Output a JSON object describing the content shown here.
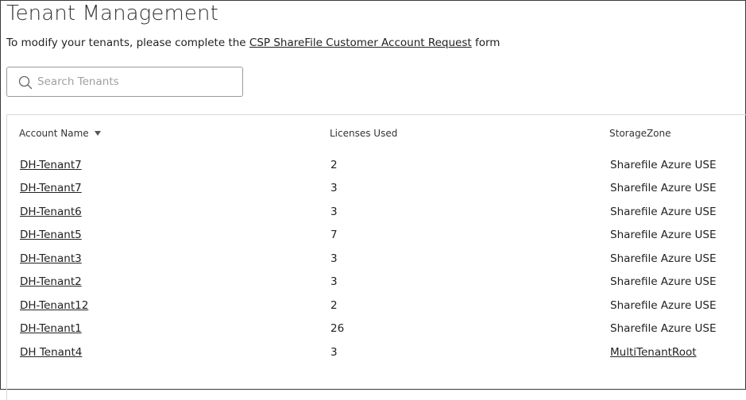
{
  "page": {
    "title": "Tenant Management",
    "subtitle_prefix": "To modify your tenants, please complete the ",
    "subtitle_link": "CSP ShareFile Customer Account Request",
    "subtitle_suffix": " form"
  },
  "search": {
    "placeholder": "Search Tenants",
    "value": ""
  },
  "table": {
    "columns": [
      "Account Name",
      "Licenses Used",
      "StorageZone"
    ],
    "sort_icon": "caret-down-icon",
    "rows": [
      {
        "account": "DH-Tenant7",
        "licenses": "2",
        "zone": "Sharefile Azure USE",
        "zone_link": false
      },
      {
        "account": "DH-Tenant7",
        "licenses": "3",
        "zone": "Sharefile Azure USE",
        "zone_link": false
      },
      {
        "account": "DH-Tenant6",
        "licenses": "3",
        "zone": "Sharefile Azure USE",
        "zone_link": false
      },
      {
        "account": "DH-Tenant5",
        "licenses": "7",
        "zone": "Sharefile Azure USE",
        "zone_link": false
      },
      {
        "account": "DH-Tenant3",
        "licenses": "3",
        "zone": "Sharefile Azure USE",
        "zone_link": false
      },
      {
        "account": "DH-Tenant2",
        "licenses": "3",
        "zone": "Sharefile Azure USE",
        "zone_link": false
      },
      {
        "account": "DH-Tenant12",
        "licenses": "2",
        "zone": "Sharefile Azure USE",
        "zone_link": false
      },
      {
        "account": "DH-Tenant1",
        "licenses": "26",
        "zone": "Sharefile Azure USE",
        "zone_link": false
      },
      {
        "account": "DH Tenant4",
        "licenses": "3",
        "zone": "MultiTenantRoot",
        "zone_link": true
      }
    ]
  }
}
